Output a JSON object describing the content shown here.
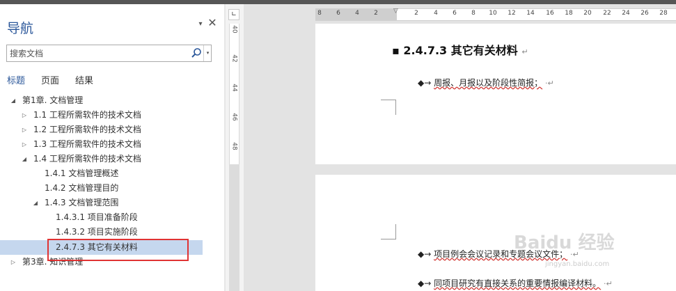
{
  "nav": {
    "title": "导航",
    "menu_icon": "▾",
    "close_icon": "✕",
    "search": {
      "placeholder": "搜索文档",
      "dropdown_icon": "▾"
    },
    "tabs": [
      "标题",
      "页面",
      "结果"
    ],
    "active_tab": "标题",
    "tree": [
      {
        "label": "第1章. 文档管理",
        "arrow": "◢",
        "level": 0
      },
      {
        "label": "1.1 工程所需软件的技术文档",
        "arrow": "▷",
        "level": 1
      },
      {
        "label": "1.2 工程所需软件的技术文档",
        "arrow": "▷",
        "level": 1
      },
      {
        "label": "1.3 工程所需软件的技术文档",
        "arrow": "▷",
        "level": 1
      },
      {
        "label": "1.4 工程所需软件的技术文档",
        "arrow": "◢",
        "level": 1
      },
      {
        "label": "1.4.1 文档管理概述",
        "arrow": "",
        "level": 2
      },
      {
        "label": "1.4.2 文档管理目的",
        "arrow": "",
        "level": 2
      },
      {
        "label": "1.4.3 文档管理范围",
        "arrow": "◢",
        "level": 2
      },
      {
        "label": "1.4.3.1 项目准备阶段",
        "arrow": "",
        "level": 3
      },
      {
        "label": "1.4.3.2 项目实施阶段",
        "arrow": "",
        "level": 3
      },
      {
        "label": "2.4.7.3 其它有关材料",
        "arrow": "",
        "level": 3,
        "selected": true
      },
      {
        "label": "第3章. 知识管理",
        "arrow": "▷",
        "level": 0
      }
    ]
  },
  "rulers": {
    "corner_icon": "∟",
    "vertical_ticks": [
      "40",
      "42",
      "44",
      "46",
      "48"
    ],
    "horizontal_ticks": [
      "8",
      "6",
      "4",
      "2",
      "2",
      "4",
      "6",
      "8",
      "10",
      "12",
      "14",
      "16",
      "18",
      "20",
      "22",
      "24",
      "26",
      "28"
    ]
  },
  "document": {
    "heading": "2.4.7.3 其它有关材料",
    "heading_marker": "▪",
    "paragraph_mark": "↵",
    "bullets": [
      {
        "symbol": "◆→",
        "text": "周报、月报以及阶段性简报；",
        "mark": "·↵"
      },
      {
        "symbol": "◆→",
        "text": "项目例会会议记录和专题会议文件；",
        "mark": "·↵"
      },
      {
        "symbol": "◆→",
        "text": "同项目研究有直接关系的重要情报编译材料。",
        "mark": "·↵"
      }
    ]
  },
  "watermark": {
    "text": "Baidu 经验",
    "url": "jingyan.baidu.com"
  },
  "colors": {
    "accent": "#2b579a",
    "selection": "#c5d7ee",
    "highlight_box": "#e03333"
  }
}
